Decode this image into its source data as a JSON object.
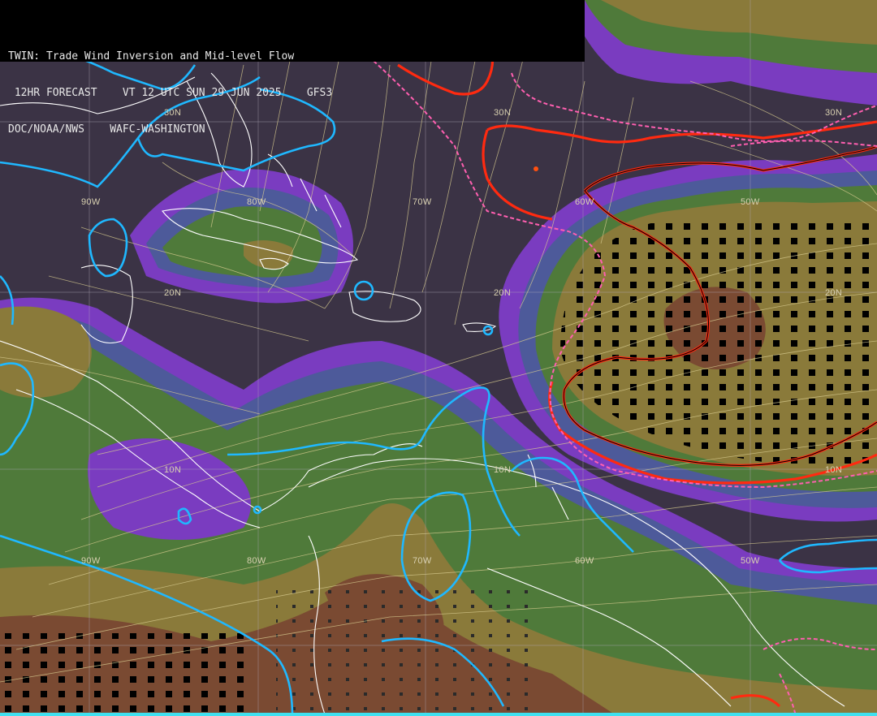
{
  "header": {
    "line1": "TWIN: Trade Wind Inversion and Mid-level Flow",
    "line2": " 12HR FORECAST    VT 12 UTC SUN 29 JUN 2025    GFS3",
    "line3": "DOC/NOAA/NWS    WAFC-WASHINGTON"
  },
  "grid_labels": {
    "lat_30n": "30N",
    "lat_20n": "20N",
    "lat_10n": "10N",
    "lon_90w": "90W",
    "lon_80w": "80W",
    "lon_70w": "70W",
    "lon_60w": "60W",
    "lon_50w": "50W"
  },
  "colors": {
    "background": "#3b3345",
    "purple": "#7a3cc0",
    "blue": "#4d5a9a",
    "green": "#4f7a3a",
    "olive": "#8a7a3a",
    "brown": "#7a4a32",
    "cyan_contour": "#1fb8ff",
    "red_contour": "#ff2a10",
    "pink_dashed": "#ff5fb0",
    "streamline": "#d8cc90",
    "coastline": "#ffffff",
    "grid": "#b0a8b8"
  }
}
